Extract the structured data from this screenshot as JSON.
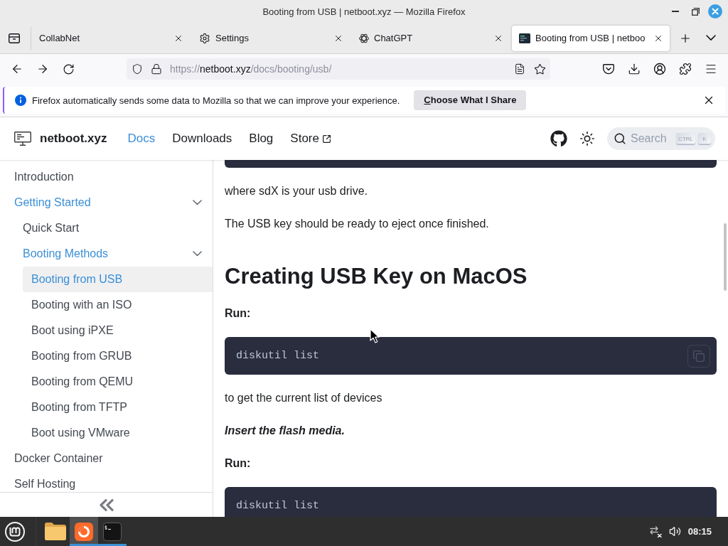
{
  "window": {
    "title": "Booting from USB | netboot.xyz — Mozilla Firefox"
  },
  "tabs": [
    {
      "label": "CollabNet",
      "kind": "plain",
      "selected": false
    },
    {
      "label": "Settings",
      "kind": "settings",
      "selected": false
    },
    {
      "label": "ChatGPT",
      "kind": "chatgpt",
      "selected": false
    },
    {
      "label": "Booting from USB | netboo",
      "kind": "site",
      "selected": true
    }
  ],
  "address_bar": {
    "scheme": "https://",
    "host": "netboot.xyz",
    "path": "/docs/booting/usb/"
  },
  "notification": {
    "message": "Firefox automatically sends some data to Mozilla so that we can improve your experience.",
    "button": "Choose What I Share"
  },
  "site_header": {
    "logo": "netboot.xyz",
    "nav": [
      {
        "label": "Docs",
        "selected": true,
        "external": false
      },
      {
        "label": "Downloads",
        "selected": false,
        "external": false
      },
      {
        "label": "Blog",
        "selected": false,
        "external": false
      },
      {
        "label": "Store",
        "selected": false,
        "external": true
      }
    ],
    "search": {
      "label": "Search",
      "keys": [
        "CTRL",
        "K"
      ]
    }
  },
  "sidebar": {
    "items": [
      {
        "label": "Introduction",
        "selected": false
      },
      {
        "label": "Getting Started",
        "selected": false,
        "expanded": true,
        "children": [
          {
            "label": "Quick Start",
            "selected": false
          },
          {
            "label": "Booting Methods",
            "selected": false,
            "expanded": true,
            "children": [
              {
                "label": "Booting from USB",
                "selected": true
              },
              {
                "label": "Booting with an ISO",
                "selected": false
              },
              {
                "label": "Boot using iPXE",
                "selected": false
              },
              {
                "label": "Booting from GRUB",
                "selected": false
              },
              {
                "label": "Booting from QEMU",
                "selected": false
              },
              {
                "label": "Booting from TFTP",
                "selected": false
              },
              {
                "label": "Boot using VMware",
                "selected": false
              }
            ]
          }
        ]
      },
      {
        "label": "Docker Container",
        "selected": false
      },
      {
        "label": "Self Hosting",
        "selected": false
      }
    ]
  },
  "article": {
    "blocks": [
      {
        "kind": "code_end"
      },
      {
        "kind": "paragraph",
        "text": "where sdX is your usb drive."
      },
      {
        "kind": "paragraph",
        "text": "The USB key should be ready to eject once finished."
      },
      {
        "kind": "heading",
        "text": "Creating USB Key on MacOS"
      },
      {
        "kind": "bold",
        "text": "Run:"
      },
      {
        "kind": "code",
        "text": "diskutil list",
        "copy_button": true
      },
      {
        "kind": "paragraph",
        "text": "to get the current list of devices"
      },
      {
        "kind": "emphasis",
        "text": "Insert the flash media."
      },
      {
        "kind": "bold",
        "text": "Run:"
      },
      {
        "kind": "code",
        "text": "diskutil list",
        "copy_button": false
      }
    ]
  },
  "taskbar": {
    "apps": [
      {
        "kind": "files",
        "running": false,
        "active": false
      },
      {
        "kind": "firefox",
        "running": true,
        "active": true
      },
      {
        "kind": "terminal",
        "running": true,
        "active": false
      }
    ],
    "clock": "08:15"
  }
}
